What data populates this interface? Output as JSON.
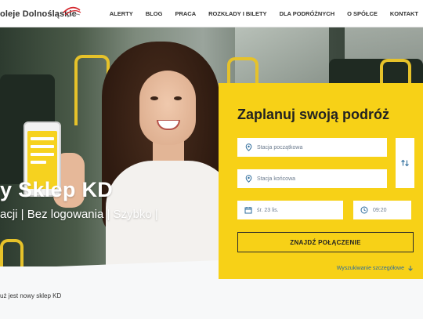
{
  "header": {
    "logo_text": "oleje Dolnośląskie",
    "nav": [
      "ALERTY",
      "BLOG",
      "PRACA",
      "ROZKŁADY I BILETY",
      "DLA PODRÓŻNYCH",
      "O SPÓŁCE",
      "KONTAKT"
    ]
  },
  "hero": {
    "promo_title": "y Sklep KD",
    "promo_subtitle": "acji | Bez logowania | Szybko |"
  },
  "planner": {
    "title": "Zaplanuj swoją podróż",
    "from_placeholder": "Stacja początkowa",
    "to_placeholder": "Stacja końcowa",
    "date_value": "śr. 23 lis.",
    "time_value": "09:20",
    "search_button": "ZNAJDŹ POŁĄCZENIE",
    "advanced_link": "Wyszukiwanie szczegółowe"
  },
  "promo_note": "uż jest nowy sklep KD",
  "colors": {
    "accent_yellow": "#f7d117",
    "icon_blue": "#2d6c9c",
    "text_dark": "#222222"
  },
  "icons": {
    "location": "location-pin-icon",
    "swap": "swap-arrows-icon",
    "calendar": "calendar-icon",
    "clock": "clock-icon",
    "arrow_down": "arrow-down-icon"
  }
}
